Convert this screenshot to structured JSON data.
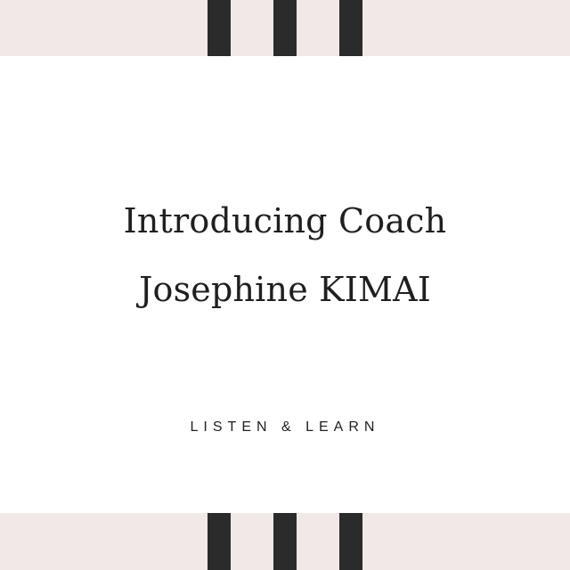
{
  "headline": {
    "line1": "Introducing Coach",
    "line2": "Josephine KIMAI"
  },
  "tagline": "LISTEN & LEARN",
  "colors": {
    "band": "#f1e9e7",
    "stripe": "#2b2b2b",
    "card": "#ffffff",
    "text": "#1f1f1f"
  }
}
